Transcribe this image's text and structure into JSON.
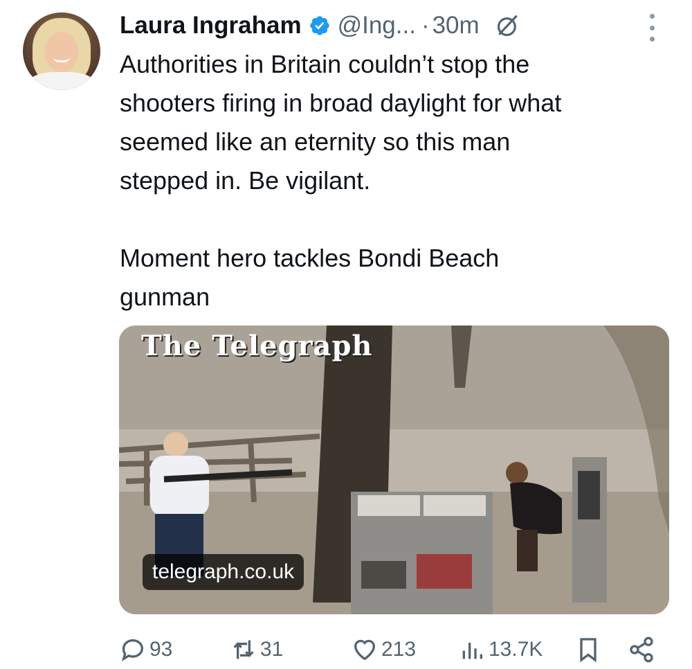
{
  "author": {
    "name": "Laura Ingraham",
    "handle": "@Ing...",
    "separator": "·",
    "time": "30m",
    "verified_color": "#1d9bf0"
  },
  "tweet": {
    "line1": "Authorities in Britain couldn’t stop the\nshooters firing in broad daylight for what\nseemed like an eternity so this man\nstepped in. Be vigilant.",
    "line2": "Moment hero tackles Bondi Beach\ngunman"
  },
  "media": {
    "masthead": "The Telegraph",
    "domain": "telegraph.co.uk"
  },
  "actions": {
    "replies": "93",
    "reposts": "31",
    "likes": "213",
    "views": "13.7K"
  },
  "icons": [
    "verified-badge-icon",
    "grok-icon",
    "more-icon",
    "reply-icon",
    "repost-icon",
    "like-icon",
    "views-icon",
    "bookmark-icon",
    "share-icon"
  ]
}
